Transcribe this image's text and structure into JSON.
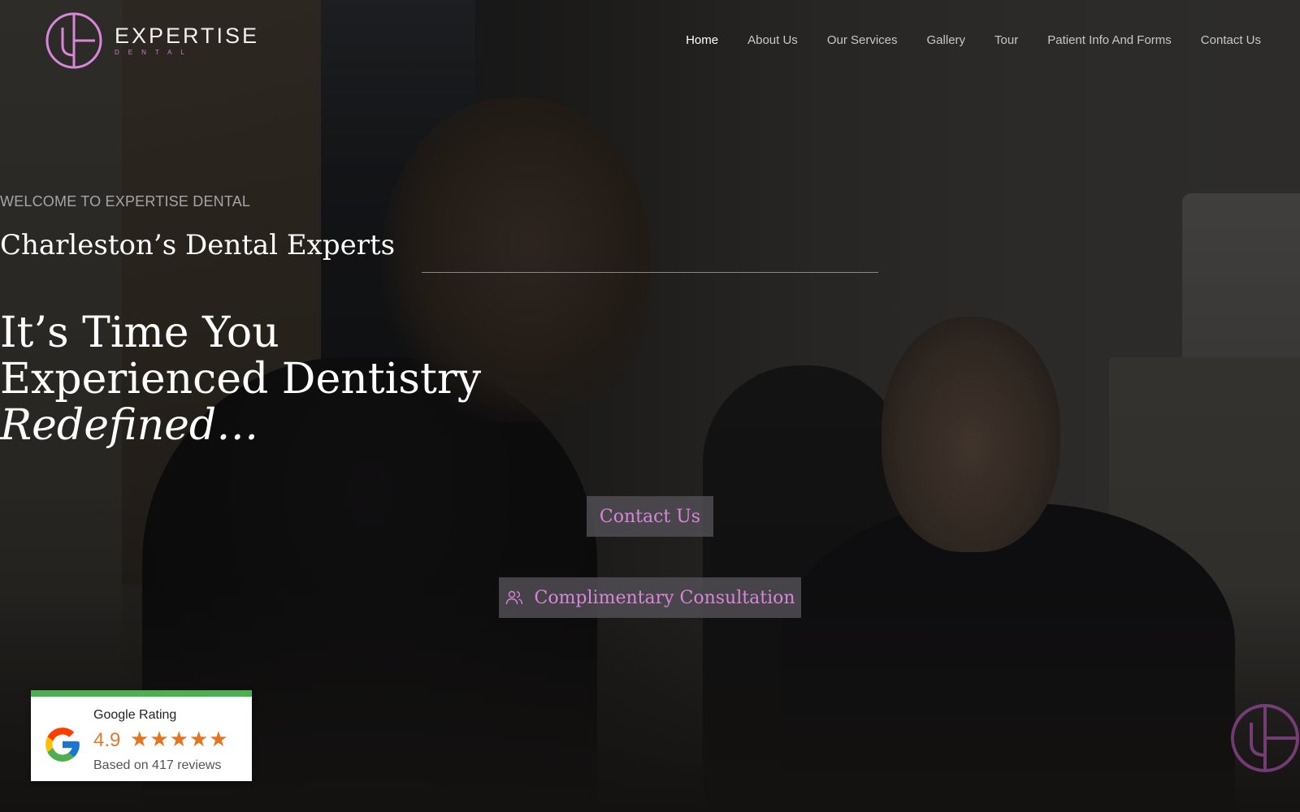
{
  "brand": {
    "name": "EXPERTISE",
    "sub": "DENTAL",
    "accent_color": "#d886d8"
  },
  "nav": {
    "items": [
      {
        "label": "Home",
        "active": true
      },
      {
        "label": "About Us",
        "active": false
      },
      {
        "label": "Our Services",
        "active": false
      },
      {
        "label": "Gallery",
        "active": false
      },
      {
        "label": "Tour",
        "active": false
      },
      {
        "label": "Patient Info And Forms",
        "active": false
      },
      {
        "label": "Contact Us",
        "active": false
      }
    ]
  },
  "hero": {
    "welcome": "WELCOME TO EXPERTISE DENTAL",
    "tagline": "Charleston’s Dental Experts",
    "headline_line1": "It’s Time You",
    "headline_line2": "Experienced Dentistry",
    "headline_line3": "Redefined…",
    "contact_button": "Contact Us",
    "consult_button": "Complimentary Consultation",
    "consult_icon": "users-icon"
  },
  "rating": {
    "title": "Google Rating",
    "score": "4.9",
    "stars": 5,
    "reviews": "Based on 417 reviews",
    "bar_color": "#4caf50",
    "star_color": "#e8731f"
  }
}
